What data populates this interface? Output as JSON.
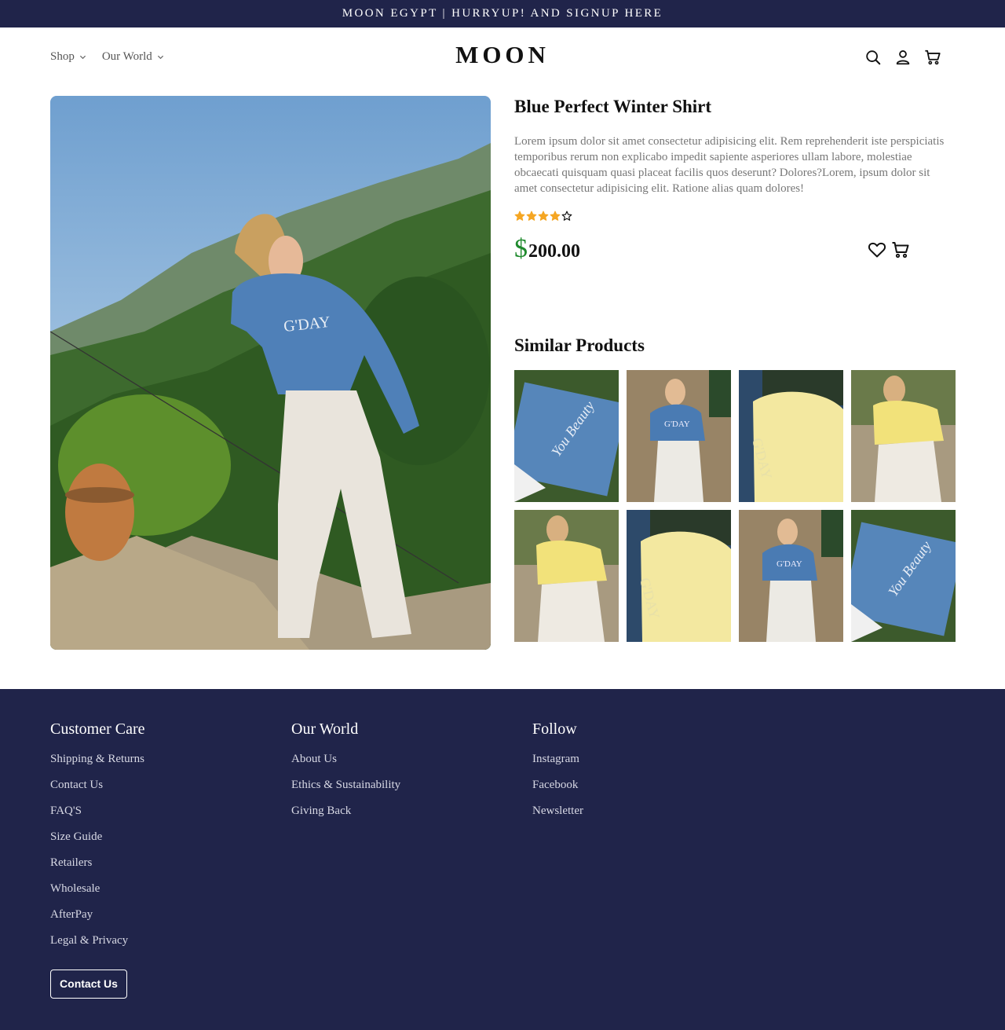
{
  "announcement": "MOON EGYPT | HURRYUP! AND SIGNUP HERE",
  "nav": {
    "items": [
      {
        "label": "Shop"
      },
      {
        "label": "Our World"
      }
    ],
    "logo": "MOON",
    "icons": [
      "search-icon",
      "user-icon",
      "cart-icon"
    ]
  },
  "product": {
    "title": "Blue Perfect Winter Shirt",
    "description": "Lorem ipsum dolor sit amet consectetur adipisicing elit. Rem reprehenderit iste perspiciatis temporibus rerum non explicabo impedit sapiente asperiores ullam labore, molestiae obcaecati quisquam quasi placeat facilis quos deserunt? Dolores?Lorem, ipsum dolor sit amet consectetur adipisicing elit. Ratione alias quam dolores!",
    "rating": 4,
    "rating_max": 5,
    "currency": "$",
    "price": "200.00",
    "currency_color": "#1f8a2d",
    "star_color": "#f5a623"
  },
  "similar": {
    "title": "Similar Products",
    "items": [
      {
        "kind": "blue-flat"
      },
      {
        "kind": "blue-model"
      },
      {
        "kind": "yellow-flat"
      },
      {
        "kind": "yellow-model"
      },
      {
        "kind": "yellow-model"
      },
      {
        "kind": "yellow-flat"
      },
      {
        "kind": "blue-model"
      },
      {
        "kind": "blue-flat"
      }
    ]
  },
  "footer": {
    "background": "#20244a",
    "columns": [
      {
        "title": "Customer Care",
        "links": [
          "Shipping & Returns",
          "Contact Us",
          "FAQ'S",
          "Size Guide",
          "Retailers",
          "Wholesale",
          "AfterPay",
          "Legal & Privacy"
        ]
      },
      {
        "title": "Our World",
        "links": [
          "About Us",
          "Ethics & Sustainability",
          "Giving Back"
        ]
      },
      {
        "title": "Follow",
        "links": [
          "Instagram",
          "Facebook",
          "Newsletter"
        ]
      }
    ],
    "button": "Contact Us"
  }
}
